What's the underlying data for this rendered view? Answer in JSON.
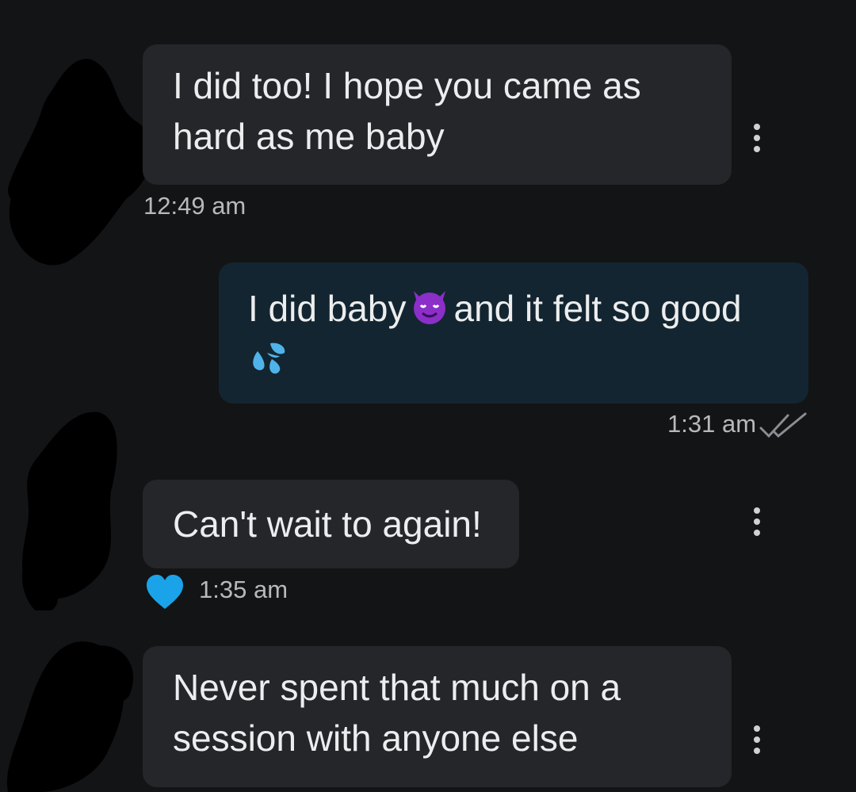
{
  "messages": [
    {
      "direction": "received",
      "text": "I did too! I hope you came as\nhard as me baby",
      "time": "12:49 am"
    },
    {
      "direction": "sent",
      "text_before_emoji": "I did baby",
      "emoji_1": "smiling-imp-emoji",
      "text_after_emoji": "and it felt so good",
      "emoji_2": "sweat-droplets-emoji",
      "time": "1:31 am",
      "status": "read"
    },
    {
      "direction": "received",
      "text": "Can't wait to again!",
      "time": "1:35 am",
      "reaction": "heart-icon",
      "reaction_color": "#1aa3e8"
    },
    {
      "direction": "received",
      "text": "Never spent that much on a\nsession with anyone else",
      "time": ""
    }
  ],
  "colors": {
    "background": "#131416",
    "received_bubble": "#24262a",
    "sent_bubble": "#132530",
    "text": "#ecedee",
    "timestamp": "#b7b9bc",
    "redaction": "#000000"
  },
  "icons": [
    "message-menu-icon",
    "read-receipt-icon",
    "heart-icon",
    "smiling-imp-emoji",
    "sweat-droplets-emoji"
  ]
}
